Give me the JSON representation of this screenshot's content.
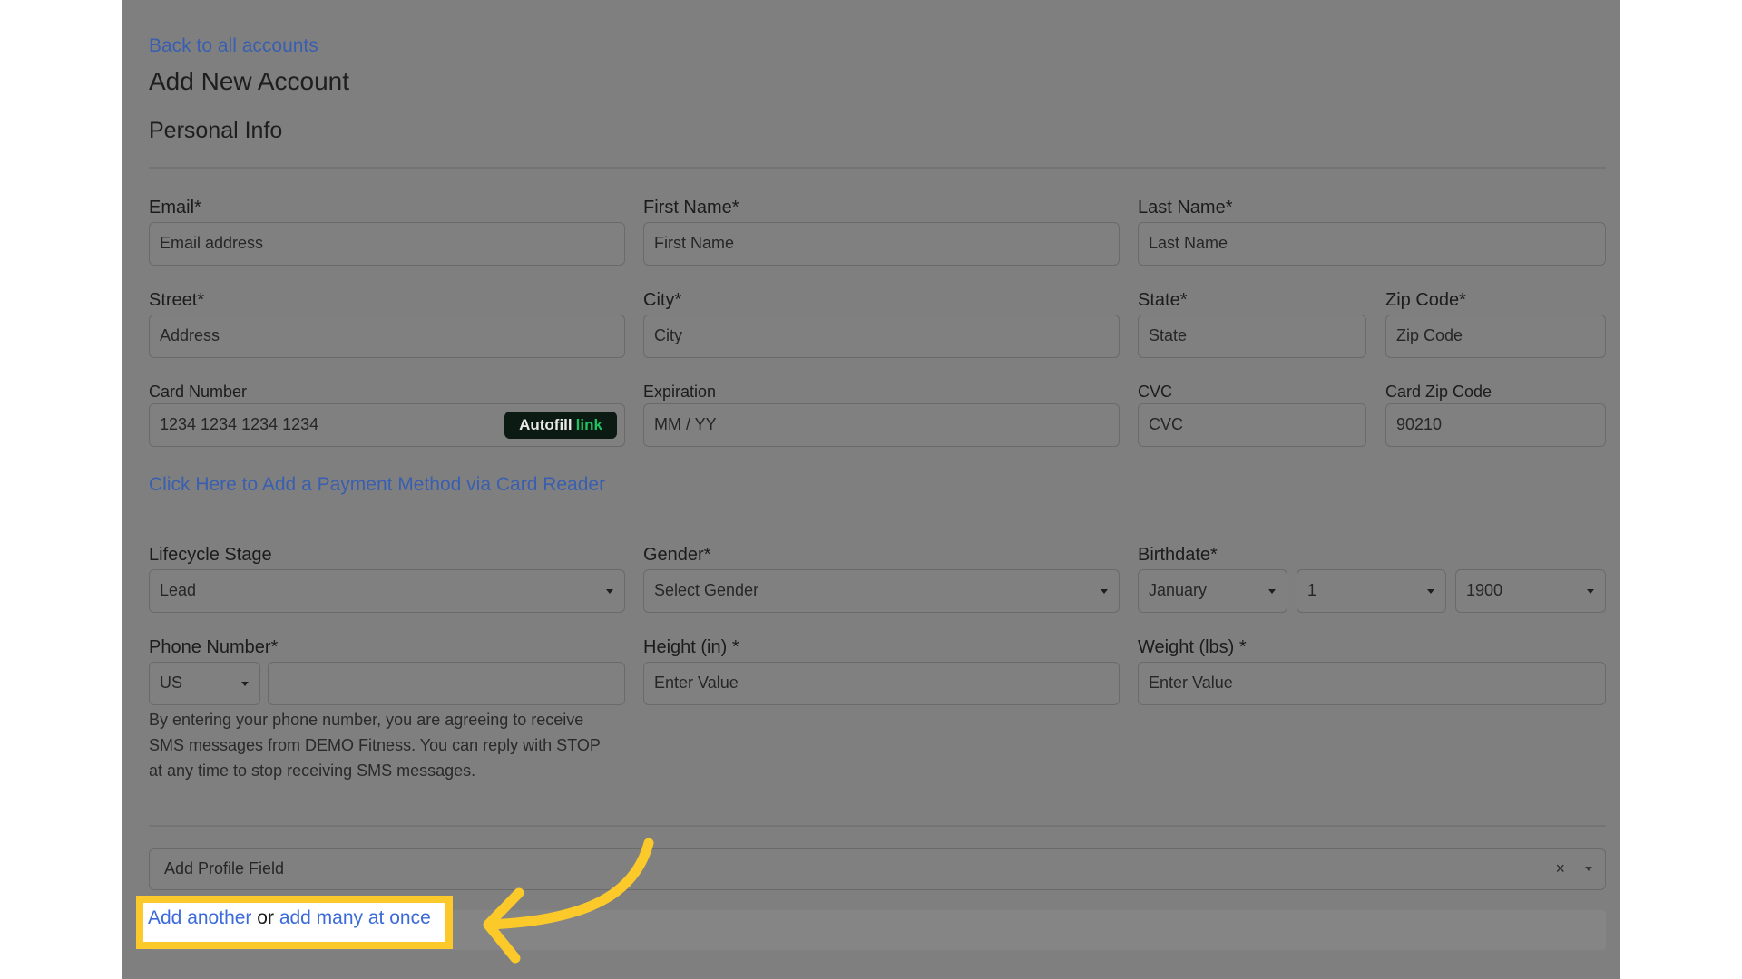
{
  "nav": {
    "back_link": "Back to all accounts"
  },
  "page": {
    "title": "Add New Account",
    "section_title": "Personal Info"
  },
  "fields": {
    "email": {
      "label": "Email*",
      "placeholder": "Email address"
    },
    "first_name": {
      "label": "First Name*",
      "placeholder": "First Name"
    },
    "last_name": {
      "label": "Last Name*",
      "placeholder": "Last Name"
    },
    "street": {
      "label": "Street*",
      "placeholder": "Address"
    },
    "city": {
      "label": "City*",
      "placeholder": "City"
    },
    "state": {
      "label": "State*",
      "placeholder": "State"
    },
    "zip": {
      "label": "Zip Code*",
      "placeholder": "Zip Code"
    },
    "card_number": {
      "label": "Card Number",
      "value": "1234 1234 1234 1234"
    },
    "autofill": {
      "text": "Autofill",
      "link": "link"
    },
    "expiration": {
      "label": "Expiration",
      "placeholder": "MM / YY"
    },
    "cvc": {
      "label": "CVC",
      "placeholder": "CVC"
    },
    "card_zip": {
      "label": "Card Zip Code",
      "value": "90210"
    },
    "card_reader_link": "Click Here to Add a Payment Method via Card Reader",
    "lifecycle": {
      "label": "Lifecycle Stage",
      "value": "Lead"
    },
    "gender": {
      "label": "Gender*",
      "value": "Select Gender"
    },
    "birthdate": {
      "label": "Birthdate*",
      "month": "January",
      "day": "1",
      "year": "1900"
    },
    "phone": {
      "label": "Phone Number*",
      "country": "US",
      "help_lines": [
        "By entering your phone number, you are agreeing to receive",
        "SMS messages from DEMO Fitness. You can reply with STOP",
        "at any time to stop receiving SMS messages."
      ]
    },
    "height": {
      "label": "Height (in) *",
      "placeholder": "Enter Value"
    },
    "weight": {
      "label": "Weight (lbs) *",
      "placeholder": "Enter Value"
    },
    "profile_field": {
      "placeholder": "Add Profile Field",
      "clear": "×"
    }
  },
  "footer": {
    "add_another": "Add another",
    "or": "or",
    "add_many": "add many at once"
  },
  "colors": {
    "highlight": "#fbca2a",
    "arrow": "#fbca2a",
    "link": "#3c6bd9",
    "overlay": "#7f7f7f"
  }
}
